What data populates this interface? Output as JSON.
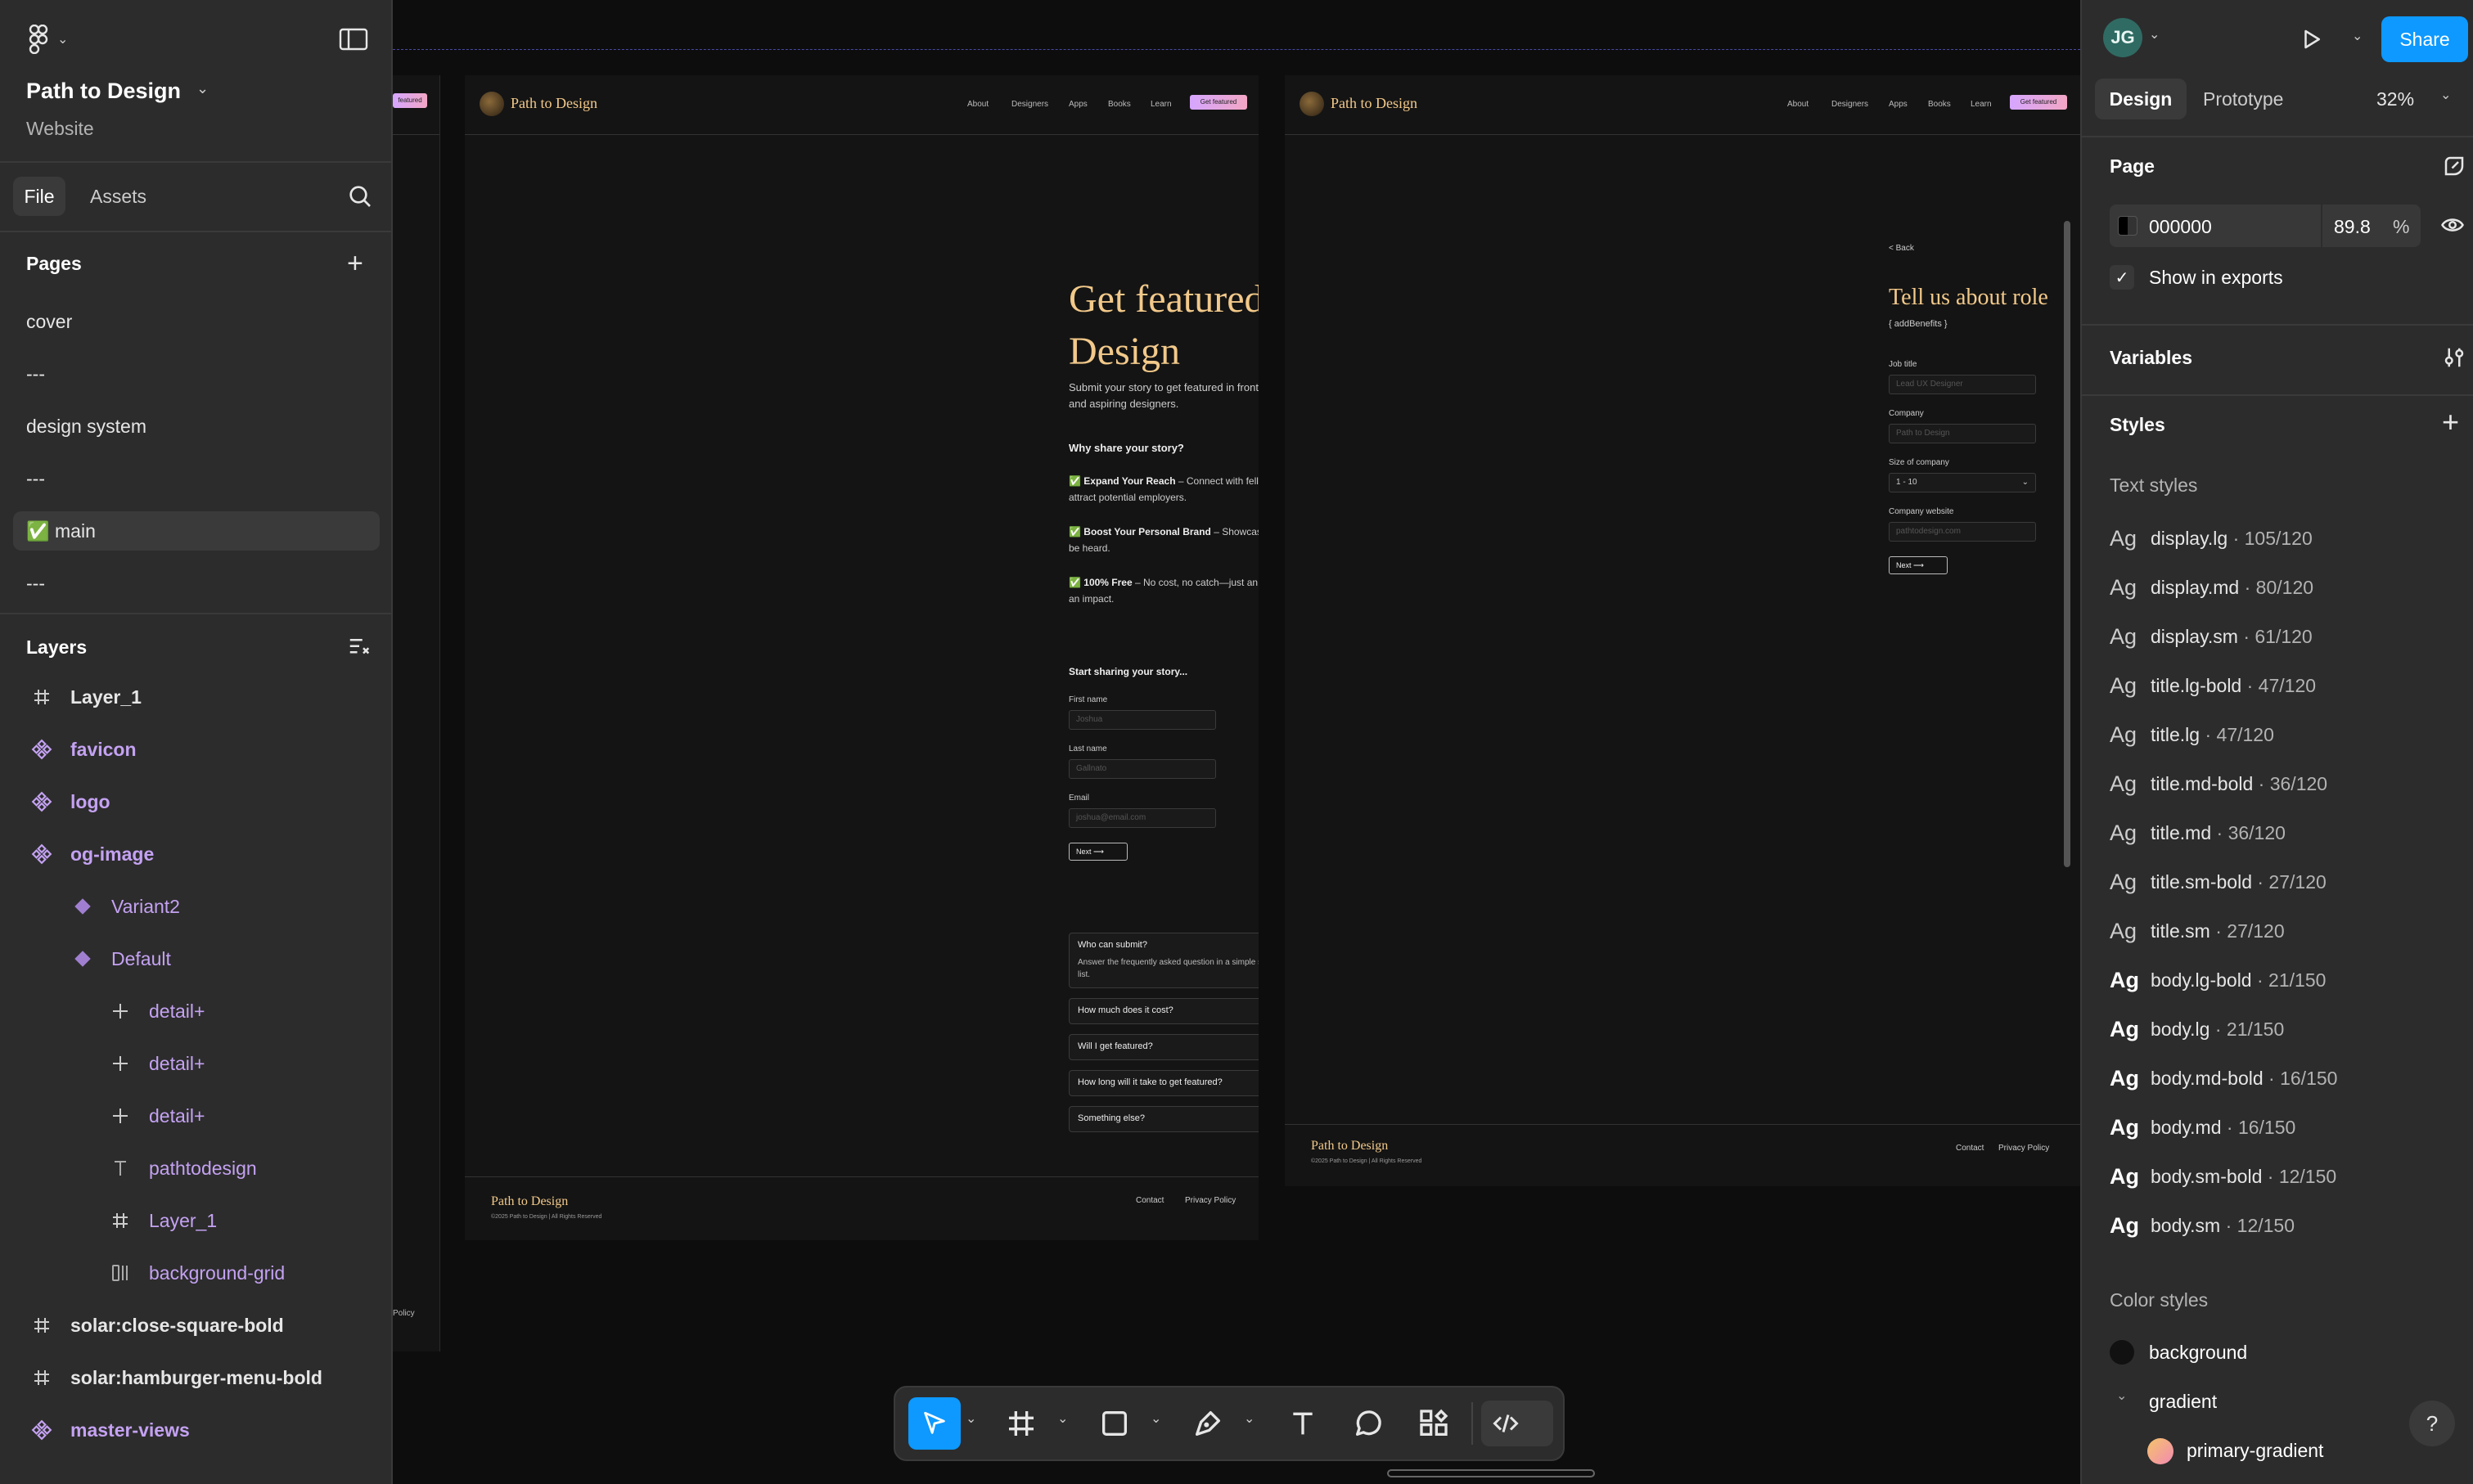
{
  "sidebar": {
    "project_title": "Path to Design",
    "project_subtitle": "Website",
    "tabs": [
      "File",
      "Assets"
    ],
    "pages_heading": "Pages",
    "pages": [
      "cover",
      "---",
      "design system",
      "---",
      "✅ main",
      "---"
    ],
    "layers_heading": "Layers",
    "layers": [
      {
        "name": "Layer_1",
        "icon": "frame-icon",
        "indent": 0,
        "component": false
      },
      {
        "name": "favicon",
        "icon": "component-icon",
        "indent": 0,
        "component": true
      },
      {
        "name": "logo",
        "icon": "component-icon",
        "indent": 0,
        "component": true
      },
      {
        "name": "og-image",
        "icon": "component-icon",
        "indent": 0,
        "component": true
      },
      {
        "name": "Variant2",
        "icon": "variant-icon",
        "indent": 1,
        "component": false
      },
      {
        "name": "Default",
        "icon": "variant-icon",
        "indent": 1,
        "component": false
      },
      {
        "name": "detail+",
        "icon": "plus-icon",
        "indent": 2,
        "component": false
      },
      {
        "name": "detail+",
        "icon": "plus-icon",
        "indent": 2,
        "component": false
      },
      {
        "name": "detail+",
        "icon": "plus-icon",
        "indent": 2,
        "component": false
      },
      {
        "name": "pathtodesign",
        "icon": "text-icon",
        "indent": 2,
        "component": false
      },
      {
        "name": "Layer_1",
        "icon": "frame-icon",
        "indent": 2,
        "component": false
      },
      {
        "name": "background-grid",
        "icon": "grid-icon",
        "indent": 2,
        "component": false
      },
      {
        "name": "solar:close-square-bold",
        "icon": "frame-icon",
        "indent": 0,
        "component": false
      },
      {
        "name": "solar:hamburger-menu-bold",
        "icon": "frame-icon",
        "indent": 0,
        "component": false
      },
      {
        "name": "master-views",
        "icon": "component-icon",
        "indent": 0,
        "component": true
      }
    ]
  },
  "right_panel": {
    "tabs": [
      "Design",
      "Prototype"
    ],
    "zoom": "32%",
    "share_label": "Share",
    "page_heading": "Page",
    "page_color": "000000",
    "page_opacity": "89.8",
    "percent": "%",
    "show_in_exports": "Show in exports",
    "variables_heading": "Variables",
    "styles_heading": "Styles",
    "text_styles_heading": "Text styles",
    "text_styles": [
      {
        "name": "display.lg",
        "size": " · 105/120",
        "bold": false
      },
      {
        "name": "display.md",
        "size": " · 80/120",
        "bold": false
      },
      {
        "name": "display.sm",
        "size": " · 61/120",
        "bold": false
      },
      {
        "name": "title.lg-bold",
        "size": " · 47/120",
        "bold": false
      },
      {
        "name": "title.lg",
        "size": " · 47/120",
        "bold": false
      },
      {
        "name": "title.md-bold",
        "size": " · 36/120",
        "bold": false
      },
      {
        "name": "title.md",
        "size": " · 36/120",
        "bold": false
      },
      {
        "name": "title.sm-bold",
        "size": " · 27/120",
        "bold": false
      },
      {
        "name": "title.sm",
        "size": " · 27/120",
        "bold": false
      },
      {
        "name": "body.lg-bold",
        "size": " · 21/150",
        "bold": true
      },
      {
        "name": "body.lg",
        "size": " · 21/150",
        "bold": true
      },
      {
        "name": "body.md-bold",
        "size": " · 16/150",
        "bold": true
      },
      {
        "name": "body.md",
        "size": " · 16/150",
        "bold": true
      },
      {
        "name": "body.sm-bold",
        "size": " · 12/150",
        "bold": true
      },
      {
        "name": "body.sm",
        "size": " · 12/150",
        "bold": true
      }
    ],
    "color_styles_heading": "Color styles",
    "color_styles": [
      "background",
      "gradient",
      "primary-gradient"
    ],
    "help": "?",
    "ag_glyph": "Ag"
  },
  "canvas": {
    "brand": "Path to Design",
    "nav": [
      "About",
      "Designers",
      "Apps",
      "Books",
      "Learn"
    ],
    "cta": "Get featured",
    "cta_partial": "featured",
    "frame1": {
      "heading": "Get featured on Path to Design",
      "intro": "Submit your story to get featured in front of potential employers, professionals and aspiring designers.",
      "why_heading": "Why share your story?",
      "benefits": [
        {
          "lead": "✅ Expand Your Reach",
          "text": " – Connect with fellow designers, inspire newcomers, and attract potential employers."
        },
        {
          "lead": "✅ Boost Your Personal Brand",
          "text": " – Showcase your unique journey and let your voice be heard."
        },
        {
          "lead": "✅ 100% Free",
          "text": " – No cost, no catch—just an opportunity to share your story and make an impact."
        }
      ],
      "form_heading": "Start sharing your story...",
      "fields": [
        {
          "label": "First name",
          "placeholder": "Joshua"
        },
        {
          "label": "Last name",
          "placeholder": "Gallnato"
        },
        {
          "label": "Email",
          "placeholder": "joshua@email.com"
        }
      ],
      "next": "Next",
      "faq": [
        {
          "q": "Who can submit?",
          "a": "Answer the frequently asked question in a simple sentence, a longish paragraph, or even in a list.",
          "open": true
        },
        {
          "q": "How much does it cost?",
          "open": false
        },
        {
          "q": "Will I get featured?",
          "open": false
        },
        {
          "q": "How long will it take to get featured?",
          "open": false
        },
        {
          "q": "Something else?",
          "open": false
        }
      ],
      "footer_brand": "Path to Design",
      "copyright": "©2025 Path to Design | All Rights Reserved",
      "footer_links": [
        "Contact",
        "Privacy Policy"
      ]
    },
    "frame2": {
      "back": "< Back",
      "heading": "Tell us about role",
      "subheading": "{ addBenefits }",
      "fields": [
        {
          "label": "Job title",
          "placeholder": "Lead UX Designer"
        },
        {
          "label": "Company",
          "placeholder": "Path to Design"
        },
        {
          "label": "Size of company",
          "placeholder": "1 - 10"
        },
        {
          "label": "Company website",
          "placeholder": "pathtodesign.com"
        }
      ],
      "next": "Next",
      "footer_brand": "Path to Design",
      "copyright": "©2025 Path to Design | All Rights Reserved",
      "footer_links": [
        "Contact",
        "Privacy Policy"
      ]
    },
    "left_frame_partial": "Policy"
  },
  "colors": {
    "accent": "#0d99ff",
    "heading_gold": "#f2c98a",
    "component": "#c4a2f2"
  }
}
